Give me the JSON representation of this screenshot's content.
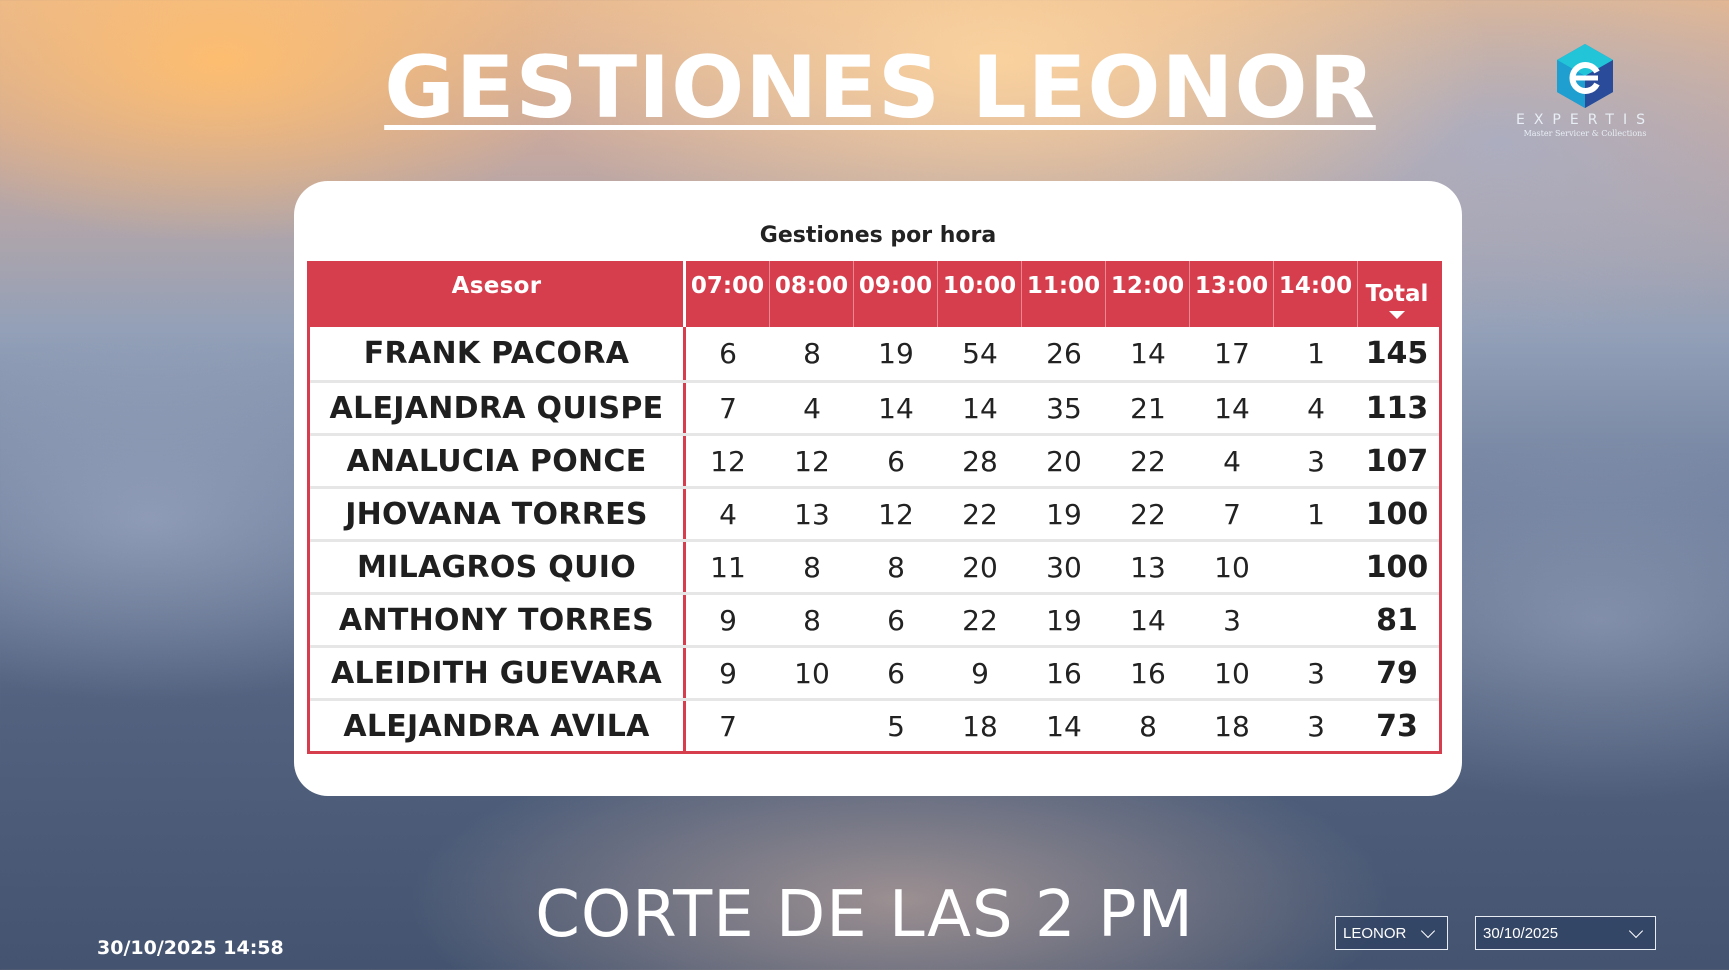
{
  "header": {
    "title": "GESTIONES LEONOR"
  },
  "logo": {
    "name": "EXPERTIS",
    "subtitle": "Master Servicer & Collections",
    "colors": [
      "#1ac0d6",
      "#1a86c9",
      "#2a3c8f"
    ]
  },
  "table": {
    "title": "Gestiones por hora",
    "columns": [
      "Asesor",
      "07:00",
      "08:00",
      "09:00",
      "10:00",
      "11:00",
      "12:00",
      "13:00",
      "14:00",
      "Total"
    ],
    "sort_indicator": "sort-descending-icon",
    "rows": [
      {
        "name": "FRANK PACORA",
        "hours": [
          "6",
          "8",
          "19",
          "54",
          "26",
          "14",
          "17",
          "1"
        ],
        "total": "145"
      },
      {
        "name": "ALEJANDRA QUISPE",
        "hours": [
          "7",
          "4",
          "14",
          "14",
          "35",
          "21",
          "14",
          "4"
        ],
        "total": "113"
      },
      {
        "name": "ANALUCIA PONCE",
        "hours": [
          "12",
          "12",
          "6",
          "28",
          "20",
          "22",
          "4",
          "3"
        ],
        "total": "107"
      },
      {
        "name": "JHOVANA TORRES",
        "hours": [
          "4",
          "13",
          "12",
          "22",
          "19",
          "22",
          "7",
          "1"
        ],
        "total": "100"
      },
      {
        "name": "MILAGROS QUIO",
        "hours": [
          "11",
          "8",
          "8",
          "20",
          "30",
          "13",
          "10",
          ""
        ],
        "total": "100"
      },
      {
        "name": "ANTHONY TORRES",
        "hours": [
          "9",
          "8",
          "6",
          "22",
          "19",
          "14",
          "3",
          ""
        ],
        "total": "81"
      },
      {
        "name": "ALEIDITH GUEVARA",
        "hours": [
          "9",
          "10",
          "6",
          "9",
          "16",
          "16",
          "10",
          "3"
        ],
        "total": "79"
      },
      {
        "name": "ALEJANDRA AVILA",
        "hours": [
          "7",
          "",
          "5",
          "18",
          "14",
          "8",
          "18",
          "3"
        ],
        "total": "73"
      }
    ],
    "header_color": "#d63e4e"
  },
  "footer": {
    "caption": "CORTE DE LAS 2 PM",
    "timestamp": "30/10/2025 14:58",
    "slicer_asesor": "LEONOR",
    "slicer_fecha": "30/10/2025"
  }
}
